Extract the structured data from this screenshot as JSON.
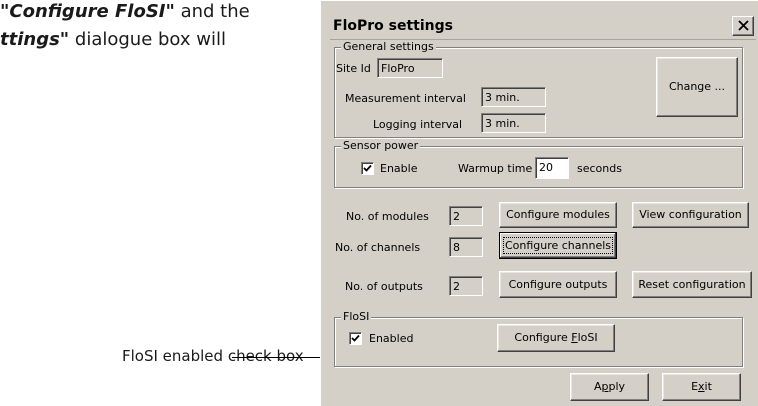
{
  "doc": {
    "line1_bold": "\"Configure FloSI\"",
    "line1_rest": " and the",
    "line2_bold": "ttings\"",
    "line2_rest": " dialogue box will",
    "callout": "FloSI enabled check box"
  },
  "dialog": {
    "title": "FloPro settings",
    "general": {
      "title": "General settings",
      "site_id_label": "Site Id",
      "site_id_value": "FloPro",
      "measurement_label": "Measurement interval",
      "measurement_value": "3 min.",
      "logging_label": "Logging interval",
      "logging_value": "3 min.",
      "change_button": "Change ..."
    },
    "sensor": {
      "title": "Sensor power",
      "enable_label": "Enable",
      "enable_checked": true,
      "warmup_label": "Warmup time",
      "warmup_value": "20",
      "warmup_unit": "seconds"
    },
    "counts": {
      "modules_label": "No. of modules",
      "modules_value": "2",
      "configure_modules": "Configure modules",
      "view_configuration": "View configuration",
      "channels_label": "No. of channels",
      "channels_value": "8",
      "configure_channels": "Configure channels",
      "outputs_label": "No. of outputs",
      "outputs_value": "2",
      "configure_outputs": "Configure outputs",
      "reset_configuration": "Reset configuration"
    },
    "flosi": {
      "title": "FloSI",
      "enabled_label": "Enabled",
      "enabled_checked": true,
      "configure_prefix": "Configure ",
      "configure_mnemonic": "F",
      "configure_suffix": "loSI"
    },
    "footer": {
      "apply_prefix": "A",
      "apply_mnemonic": "p",
      "apply_suffix": "ply",
      "exit_prefix": "E",
      "exit_mnemonic": "x",
      "exit_suffix": "it"
    }
  }
}
